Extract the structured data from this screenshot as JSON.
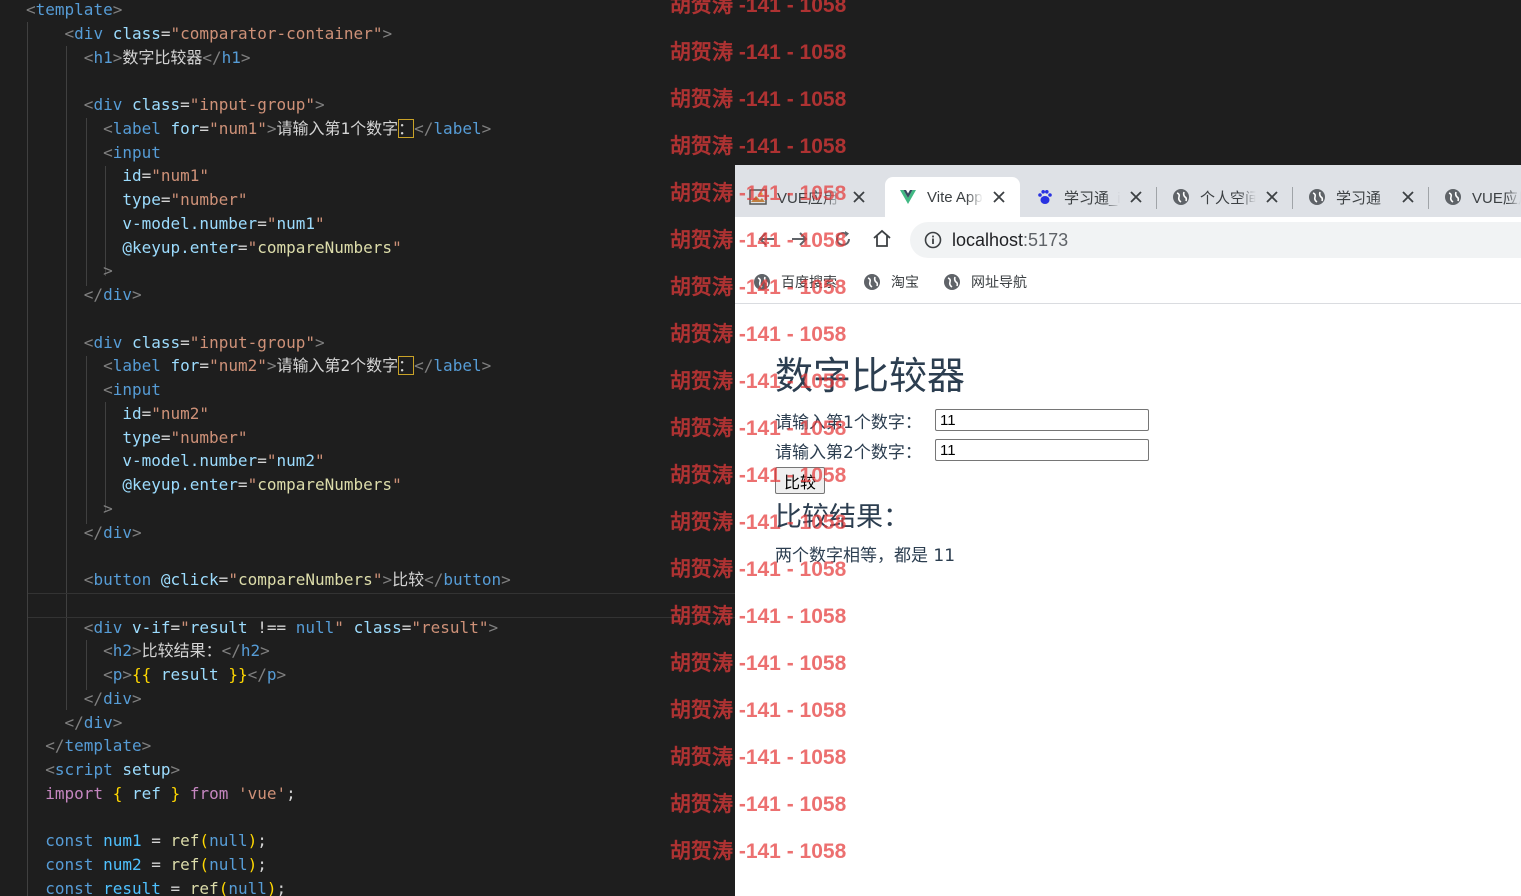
{
  "editor": {
    "lines": [
      [
        [
          "punct",
          "<"
        ],
        [
          "tag",
          "template"
        ],
        [
          "punct",
          ">"
        ]
      ],
      [
        [
          "text",
          "    "
        ],
        [
          "punct",
          "<"
        ],
        [
          "tag",
          "div"
        ],
        [
          "text",
          " "
        ],
        [
          "attr",
          "class"
        ],
        [
          "text",
          "="
        ],
        [
          "str",
          "\"comparator-container\""
        ],
        [
          "punct",
          ">"
        ]
      ],
      [
        [
          "text",
          "      "
        ],
        [
          "punct",
          "<"
        ],
        [
          "tag",
          "h1"
        ],
        [
          "punct",
          ">"
        ],
        [
          "text",
          "数字比较器"
        ],
        [
          "punct",
          "</"
        ],
        [
          "tag",
          "h1"
        ],
        [
          "punct",
          ">"
        ]
      ],
      [],
      [
        [
          "text",
          "      "
        ],
        [
          "punct",
          "<"
        ],
        [
          "tag",
          "div"
        ],
        [
          "text",
          " "
        ],
        [
          "attr",
          "class"
        ],
        [
          "text",
          "="
        ],
        [
          "str",
          "\"input-group\""
        ],
        [
          "punct",
          ">"
        ]
      ],
      [
        [
          "text",
          "        "
        ],
        [
          "punct",
          "<"
        ],
        [
          "tag",
          "label"
        ],
        [
          "text",
          " "
        ],
        [
          "attr",
          "for"
        ],
        [
          "text",
          "="
        ],
        [
          "str",
          "\"num1\""
        ],
        [
          "punct",
          ">"
        ],
        [
          "text",
          "请输入第1个数字"
        ],
        [
          "box",
          "："
        ],
        [
          "punct",
          "</"
        ],
        [
          "tag",
          "label"
        ],
        [
          "punct",
          ">"
        ]
      ],
      [
        [
          "text",
          "        "
        ],
        [
          "punct",
          "<"
        ],
        [
          "tag",
          "input"
        ]
      ],
      [
        [
          "text",
          "          "
        ],
        [
          "attr",
          "id"
        ],
        [
          "text",
          "="
        ],
        [
          "str",
          "\"num1\""
        ]
      ],
      [
        [
          "text",
          "          "
        ],
        [
          "attr",
          "type"
        ],
        [
          "text",
          "="
        ],
        [
          "str",
          "\"number\""
        ]
      ],
      [
        [
          "text",
          "          "
        ],
        [
          "attr",
          "v-model.number"
        ],
        [
          "text",
          "="
        ],
        [
          "str",
          "\""
        ],
        [
          "var",
          "num1"
        ],
        [
          "str",
          "\""
        ]
      ],
      [
        [
          "text",
          "          "
        ],
        [
          "attr",
          "@keyup.enter"
        ],
        [
          "text",
          "="
        ],
        [
          "str",
          "\""
        ],
        [
          "fn",
          "compareNumbers"
        ],
        [
          "str",
          "\""
        ]
      ],
      [
        [
          "text",
          "        "
        ],
        [
          "punct",
          ">"
        ]
      ],
      [
        [
          "text",
          "      "
        ],
        [
          "punct",
          "</"
        ],
        [
          "tag",
          "div"
        ],
        [
          "punct",
          ">"
        ]
      ],
      [],
      [
        [
          "text",
          "      "
        ],
        [
          "punct",
          "<"
        ],
        [
          "tag",
          "div"
        ],
        [
          "text",
          " "
        ],
        [
          "attr",
          "class"
        ],
        [
          "text",
          "="
        ],
        [
          "str",
          "\"input-group\""
        ],
        [
          "punct",
          ">"
        ]
      ],
      [
        [
          "text",
          "        "
        ],
        [
          "punct",
          "<"
        ],
        [
          "tag",
          "label"
        ],
        [
          "text",
          " "
        ],
        [
          "attr",
          "for"
        ],
        [
          "text",
          "="
        ],
        [
          "str",
          "\"num2\""
        ],
        [
          "punct",
          ">"
        ],
        [
          "text",
          "请输入第2个数字"
        ],
        [
          "box",
          "："
        ],
        [
          "punct",
          "</"
        ],
        [
          "tag",
          "label"
        ],
        [
          "punct",
          ">"
        ]
      ],
      [
        [
          "text",
          "        "
        ],
        [
          "punct",
          "<"
        ],
        [
          "tag",
          "input"
        ]
      ],
      [
        [
          "text",
          "          "
        ],
        [
          "attr",
          "id"
        ],
        [
          "text",
          "="
        ],
        [
          "str",
          "\"num2\""
        ]
      ],
      [
        [
          "text",
          "          "
        ],
        [
          "attr",
          "type"
        ],
        [
          "text",
          "="
        ],
        [
          "str",
          "\"number\""
        ]
      ],
      [
        [
          "text",
          "          "
        ],
        [
          "attr",
          "v-model.number"
        ],
        [
          "text",
          "="
        ],
        [
          "str",
          "\""
        ],
        [
          "var",
          "num2"
        ],
        [
          "str",
          "\""
        ]
      ],
      [
        [
          "text",
          "          "
        ],
        [
          "attr",
          "@keyup.enter"
        ],
        [
          "text",
          "="
        ],
        [
          "str",
          "\""
        ],
        [
          "fn",
          "compareNumbers"
        ],
        [
          "str",
          "\""
        ]
      ],
      [
        [
          "text",
          "        "
        ],
        [
          "punct",
          ">"
        ]
      ],
      [
        [
          "text",
          "      "
        ],
        [
          "punct",
          "</"
        ],
        [
          "tag",
          "div"
        ],
        [
          "punct",
          ">"
        ]
      ],
      [],
      [
        [
          "text",
          "      "
        ],
        [
          "punct",
          "<"
        ],
        [
          "tag",
          "button"
        ],
        [
          "text",
          " "
        ],
        [
          "attr",
          "@click"
        ],
        [
          "text",
          "="
        ],
        [
          "str",
          "\""
        ],
        [
          "fn",
          "compareNumbers"
        ],
        [
          "str",
          "\""
        ],
        [
          "punct",
          ">"
        ],
        [
          "text",
          "比较"
        ],
        [
          "punct",
          "</"
        ],
        [
          "tag",
          "button"
        ],
        [
          "punct",
          ">"
        ]
      ],
      [],
      [
        [
          "text",
          "      "
        ],
        [
          "punct",
          "<"
        ],
        [
          "tag",
          "div"
        ],
        [
          "text",
          " "
        ],
        [
          "attr",
          "v-if"
        ],
        [
          "text",
          "="
        ],
        [
          "str",
          "\""
        ],
        [
          "var",
          "result"
        ],
        [
          "text",
          " !== "
        ],
        [
          "decl",
          "null"
        ],
        [
          "str",
          "\""
        ],
        [
          "text",
          " "
        ],
        [
          "attr",
          "class"
        ],
        [
          "text",
          "="
        ],
        [
          "str",
          "\"result\""
        ],
        [
          "punct",
          ">"
        ]
      ],
      [
        [
          "text",
          "        "
        ],
        [
          "punct",
          "<"
        ],
        [
          "tag",
          "h2"
        ],
        [
          "punct",
          ">"
        ],
        [
          "text",
          "比较结果："
        ],
        [
          "punct",
          "</"
        ],
        [
          "tag",
          "h2"
        ],
        [
          "punct",
          ">"
        ]
      ],
      [
        [
          "text",
          "        "
        ],
        [
          "punct",
          "<"
        ],
        [
          "tag",
          "p"
        ],
        [
          "punct",
          ">"
        ],
        [
          "brace",
          "{{"
        ],
        [
          "text",
          " "
        ],
        [
          "var",
          "result"
        ],
        [
          "text",
          " "
        ],
        [
          "brace",
          "}}"
        ],
        [
          "punct",
          "</"
        ],
        [
          "tag",
          "p"
        ],
        [
          "punct",
          ">"
        ]
      ],
      [
        [
          "text",
          "      "
        ],
        [
          "punct",
          "</"
        ],
        [
          "tag",
          "div"
        ],
        [
          "punct",
          ">"
        ]
      ],
      [
        [
          "text",
          "    "
        ],
        [
          "punct",
          "</"
        ],
        [
          "tag",
          "div"
        ],
        [
          "punct",
          ">"
        ]
      ],
      [
        [
          "text",
          "  "
        ],
        [
          "punct",
          "</"
        ],
        [
          "tag",
          "template"
        ],
        [
          "punct",
          ">"
        ]
      ],
      [
        [
          "text",
          "  "
        ],
        [
          "punct",
          "<"
        ],
        [
          "tag",
          "script"
        ],
        [
          "text",
          " "
        ],
        [
          "attr",
          "setup"
        ],
        [
          "punct",
          ">"
        ]
      ],
      [
        [
          "text",
          "  "
        ],
        [
          "kw",
          "import"
        ],
        [
          "text",
          " "
        ],
        [
          "brace",
          "{"
        ],
        [
          "text",
          " "
        ],
        [
          "var",
          "ref"
        ],
        [
          "text",
          " "
        ],
        [
          "brace",
          "}"
        ],
        [
          "text",
          " "
        ],
        [
          "kw",
          "from"
        ],
        [
          "text",
          " "
        ],
        [
          "str",
          "'vue'"
        ],
        [
          "text",
          ";"
        ]
      ],
      [],
      [
        [
          "text",
          "  "
        ],
        [
          "decl",
          "const"
        ],
        [
          "text",
          " "
        ],
        [
          "const",
          "num1"
        ],
        [
          "text",
          " = "
        ],
        [
          "fn",
          "ref"
        ],
        [
          "brace",
          "("
        ],
        [
          "decl",
          "null"
        ],
        [
          "brace",
          ")"
        ],
        [
          "text",
          ";"
        ]
      ],
      [
        [
          "text",
          "  "
        ],
        [
          "decl",
          "const"
        ],
        [
          "text",
          " "
        ],
        [
          "const",
          "num2"
        ],
        [
          "text",
          " = "
        ],
        [
          "fn",
          "ref"
        ],
        [
          "brace",
          "("
        ],
        [
          "decl",
          "null"
        ],
        [
          "brace",
          ")"
        ],
        [
          "text",
          ";"
        ]
      ],
      [
        [
          "text",
          "  "
        ],
        [
          "decl",
          "const"
        ],
        [
          "text",
          " "
        ],
        [
          "const",
          "result"
        ],
        [
          "text",
          " = "
        ],
        [
          "fn",
          "ref"
        ],
        [
          "brace",
          "("
        ],
        [
          "decl",
          "null"
        ],
        [
          "brace",
          ")"
        ],
        [
          "text",
          ";"
        ]
      ]
    ]
  },
  "browser": {
    "tabs": [
      {
        "label": "VUE应用",
        "icon": "image-icon",
        "active": false
      },
      {
        "label": "Vite App",
        "icon": "vue-logo-icon",
        "active": true
      },
      {
        "label": "学习通_ili",
        "icon": "baidu-paw-icon",
        "active": false
      },
      {
        "label": "个人空间",
        "icon": "globe-icon",
        "active": false
      },
      {
        "label": "学习通",
        "icon": "globe-icon",
        "active": false
      },
      {
        "label": "VUE应用",
        "icon": "globe-icon",
        "active": false
      }
    ],
    "address": {
      "host": "localhost",
      "port": ":5173"
    },
    "bookmarks": [
      {
        "label": "百度搜索",
        "icon": "globe-icon"
      },
      {
        "label": "淘宝",
        "icon": "globe-icon"
      },
      {
        "label": "网址导航",
        "icon": "globe-icon"
      }
    ]
  },
  "app": {
    "title": "数字比较器",
    "label1": "请输入第1个数字：",
    "value1": "11",
    "label2": "请输入第2个数字：",
    "value2": "11",
    "button": "比较",
    "result_heading": "比较结果：",
    "result_text": "两个数字相等，都是 11"
  },
  "watermark": {
    "text": "胡贺涛 -141 - 1058",
    "color": "#e63a3a",
    "count": 19
  }
}
